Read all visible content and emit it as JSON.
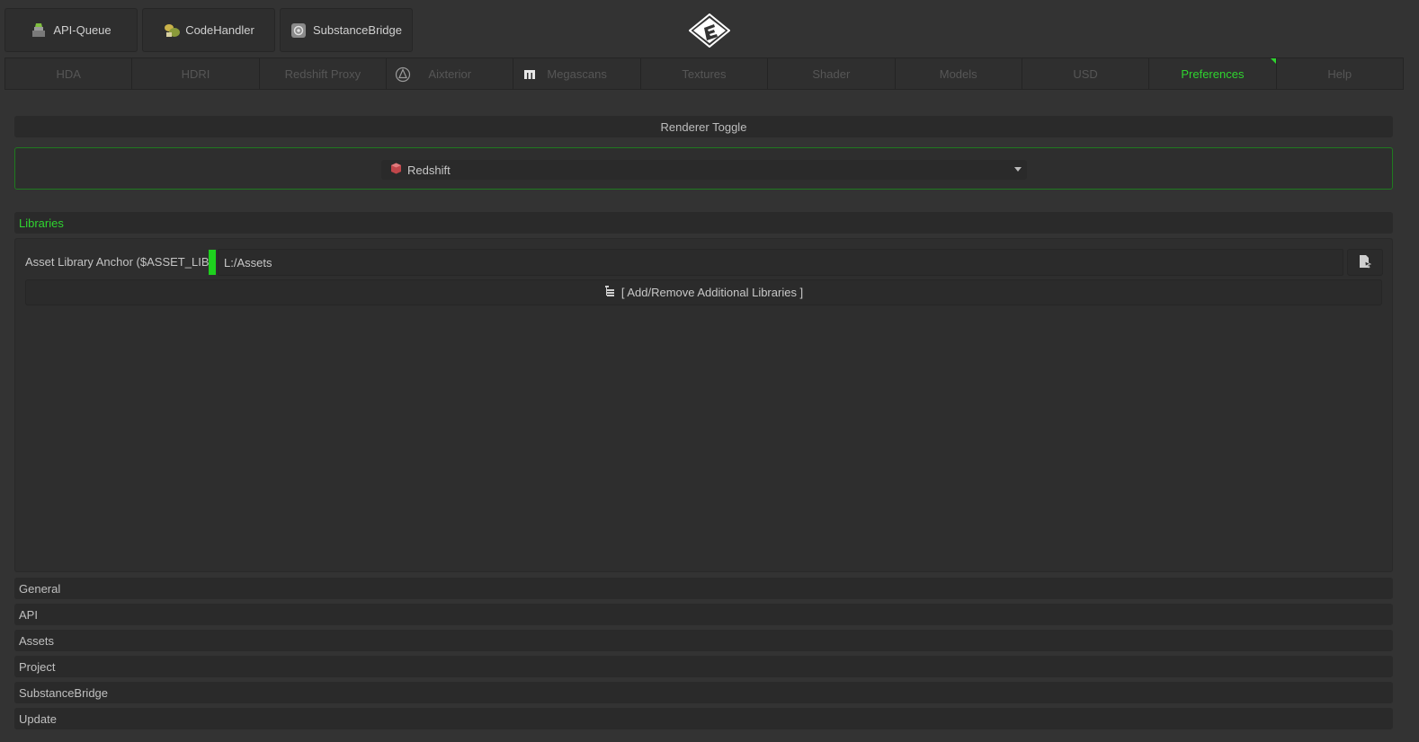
{
  "toolbar": {
    "buttons": [
      {
        "label": "API-Queue",
        "icon": "queue-icon"
      },
      {
        "label": "CodeHandler",
        "icon": "code-handler-icon"
      },
      {
        "label": "SubstanceBridge",
        "icon": "substance-icon"
      }
    ],
    "logo_icon": "app-logo-icon"
  },
  "tabs": [
    {
      "label": "HDA"
    },
    {
      "label": "HDRI"
    },
    {
      "label": "Redshift Proxy"
    },
    {
      "label": "Aixterior",
      "icon": "aixterior-icon"
    },
    {
      "label": "Megascans",
      "icon": "megascans-icon"
    },
    {
      "label": "Textures"
    },
    {
      "label": "Shader"
    },
    {
      "label": "Models"
    },
    {
      "label": "USD"
    },
    {
      "label": "Preferences",
      "active": true
    },
    {
      "label": "Help"
    }
  ],
  "renderer": {
    "title": "Renderer Toggle",
    "selected": "Redshift",
    "selected_icon": "redshift-icon"
  },
  "libraries": {
    "title": "Libraries",
    "anchor_label": "Asset Library Anchor ($ASSET_LIB)",
    "anchor_value": "L:/Assets",
    "add_remove_label": "[ Add/Remove Additional Libraries ]"
  },
  "sections": [
    "General",
    "API",
    "Assets",
    "Project",
    "SubstanceBridge",
    "Update"
  ],
  "colors": {
    "accent": "#2fd42f",
    "background": "#333333",
    "panel": "#2e2e2e",
    "inactive_tab_text": "#565656"
  }
}
